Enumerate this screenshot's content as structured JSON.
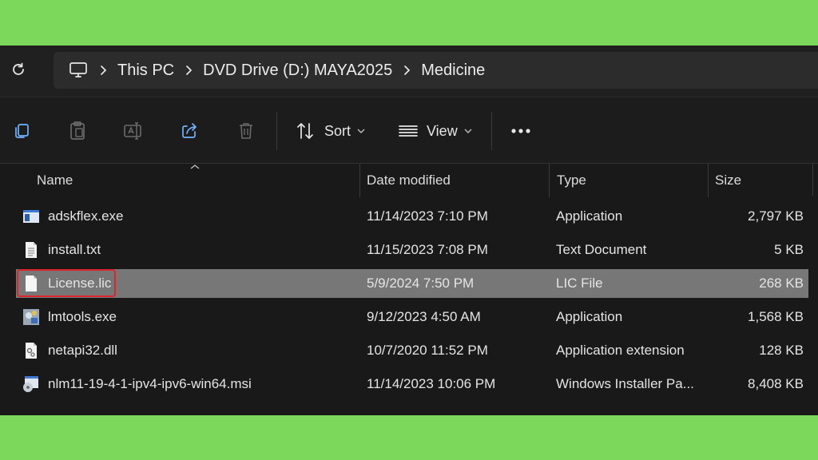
{
  "breadcrumb": {
    "items": [
      "This PC",
      "DVD Drive (D:) MAYA2025",
      "Medicine"
    ]
  },
  "toolbar": {
    "sort_label": "Sort",
    "view_label": "View"
  },
  "columns": {
    "name": "Name",
    "date": "Date modified",
    "type": "Type",
    "size": "Size"
  },
  "files": [
    {
      "name": "adskflex.exe",
      "date": "11/14/2023 7:10 PM",
      "type": "Application",
      "size": "2,797 KB",
      "icon": "application-window-icon"
    },
    {
      "name": "install.txt",
      "date": "11/15/2023 7:08 PM",
      "type": "Text Document",
      "size": "5 KB",
      "icon": "text-document-icon"
    },
    {
      "name": "License.lic",
      "date": "5/9/2024 7:50 PM",
      "type": "LIC File",
      "size": "268 KB",
      "icon": "blank-file-icon",
      "selected": true
    },
    {
      "name": "lmtools.exe",
      "date": "9/12/2023 4:50 AM",
      "type": "Application",
      "size": "1,568 KB",
      "icon": "lmtools-app-icon"
    },
    {
      "name": "netapi32.dll",
      "date": "10/7/2020 11:52 PM",
      "type": "Application extension",
      "size": "128 KB",
      "icon": "dll-gear-file-icon"
    },
    {
      "name": "nlm11-19-4-1-ipv4-ipv6-win64.msi",
      "date": "11/14/2023 10:06 PM",
      "type": "Windows Installer Pa...",
      "size": "8,408 KB",
      "icon": "installer-disc-icon"
    }
  ],
  "colors": {
    "background": "#7bd85a",
    "window": "#191919",
    "selected_row": "#777777",
    "highlight_border": "#e0242b"
  }
}
